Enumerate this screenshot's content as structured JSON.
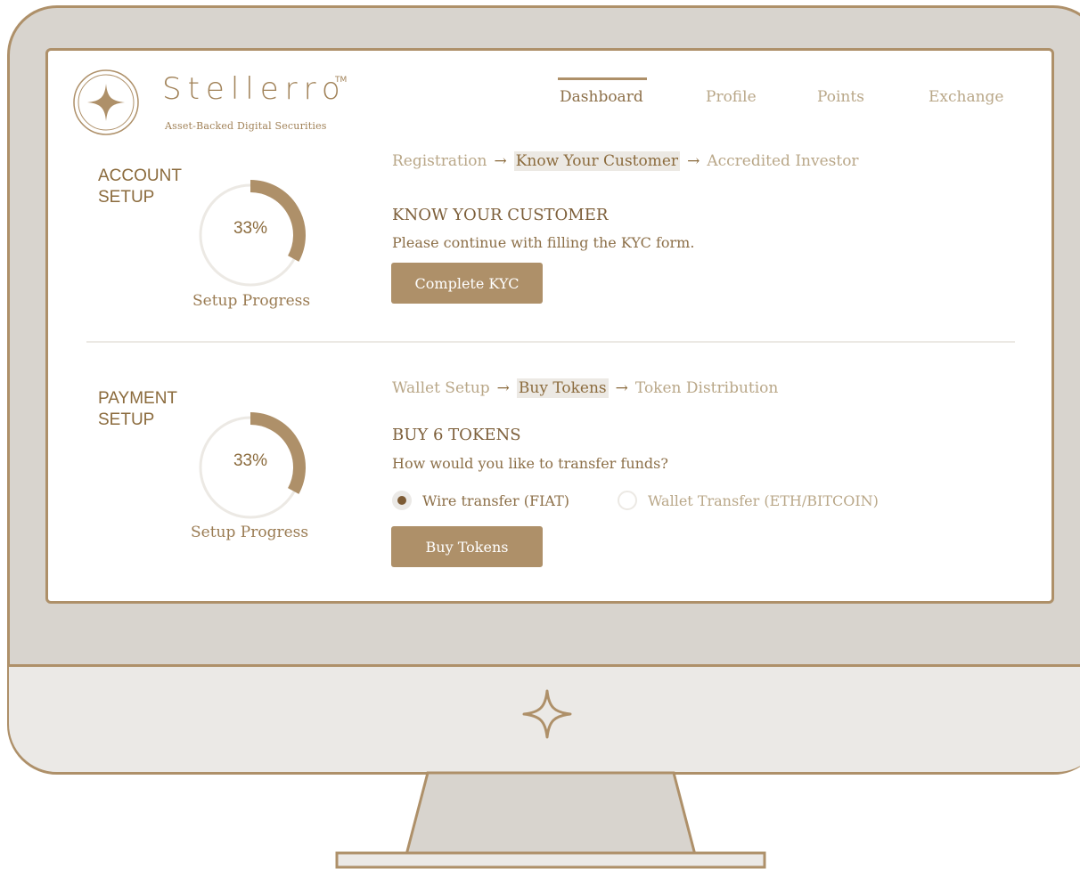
{
  "brand": {
    "name": "Stellerro",
    "trademark": "TM",
    "tagline": "Asset-Backed Digital Securities",
    "accent_color": "#ae9069"
  },
  "nav": {
    "items": [
      {
        "label": "Dashboard",
        "active": true
      },
      {
        "label": "Profile",
        "active": false
      },
      {
        "label": "Points",
        "active": false
      },
      {
        "label": "Exchange",
        "active": false
      }
    ]
  },
  "account_setup": {
    "title": "ACCOUNT\nSETUP",
    "progress": 33,
    "progress_text": "33%",
    "progress_label": "Setup Progress",
    "steps": [
      "Registration",
      "Know Your Customer",
      "Accredited Investor"
    ],
    "current_step": "Know Your Customer",
    "arrow": "→",
    "heading": "KNOW YOUR CUSTOMER",
    "description": "Please continue with filling the KYC form.",
    "button_label": "Complete KYC"
  },
  "payment_setup": {
    "title": "PAYMENT\nSETUP",
    "progress": 33,
    "progress_text": "33%",
    "progress_label": "Setup Progress",
    "steps": [
      "Wallet Setup",
      "Buy Tokens",
      "Token Distribution"
    ],
    "current_step": "Buy Tokens",
    "arrow": "→",
    "heading": "BUY 6 TOKENS",
    "question": "How would you like to transfer funds?",
    "options": [
      {
        "label": "Wire transfer (FIAT)",
        "selected": true
      },
      {
        "label": "Wallet Transfer (ETH/BITCOIN)",
        "selected": false
      }
    ],
    "button_label": "Buy Tokens"
  }
}
